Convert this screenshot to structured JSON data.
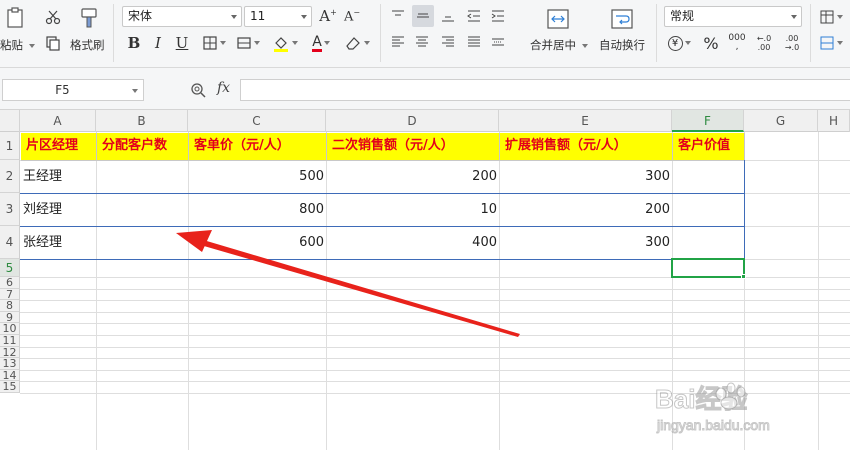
{
  "ribbon": {
    "paste_label": "粘贴",
    "format_painter_label": "格式刷",
    "font_name": "宋体",
    "font_size": "11",
    "merge_center_label": "合并居中",
    "wrap_text_label": "自动换行",
    "number_format": "常规",
    "percent_symbol": "%",
    "increase_decimal": ".00\n→.0",
    "currency_symbol": "¥"
  },
  "formula_bar": {
    "name_box": "F5",
    "fx_label": "fx",
    "formula_value": ""
  },
  "columns": [
    "A",
    "B",
    "C",
    "D",
    "E",
    "F",
    "G",
    "H"
  ],
  "rows": [
    "1",
    "2",
    "3",
    "4",
    "5",
    "6",
    "7",
    "8",
    "9",
    "10",
    "11",
    "12",
    "13",
    "14",
    "15"
  ],
  "table": {
    "headers": [
      "片区经理",
      "分配客户数",
      "客单价（元/人）",
      "二次销售额（元/人）",
      "扩展销售额（元/人）",
      "客户价值"
    ],
    "rows": [
      [
        "王经理",
        "",
        "500",
        "200",
        "300",
        ""
      ],
      [
        "刘经理",
        "",
        "800",
        "10",
        "200",
        ""
      ],
      [
        "张经理",
        "",
        "600",
        "400",
        "300",
        ""
      ]
    ]
  },
  "selected_cell": "F5",
  "annotation": {
    "type": "red-arrow",
    "color": "#e8221b"
  },
  "watermark": {
    "brand": "Bai经验",
    "domain": "jingyan.baidu.com"
  },
  "colors": {
    "header_fill": "#ffff00",
    "header_text": "#e3001b",
    "selection": "#21a346",
    "table_border": "#3e6bb8"
  }
}
